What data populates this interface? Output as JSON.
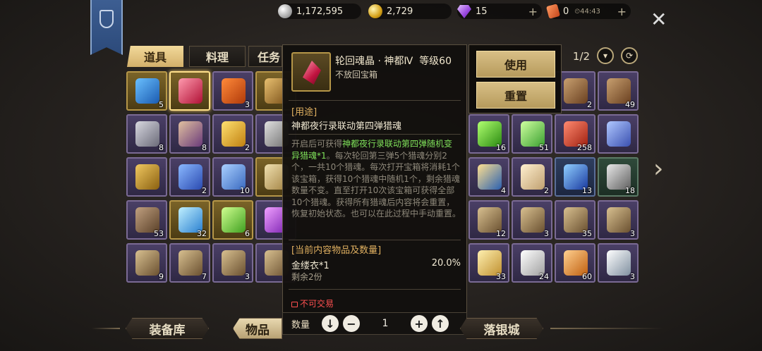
{
  "currency": {
    "silver": "1,172,595",
    "gold": "2,729",
    "gems": "15",
    "tickets": "0",
    "timer": "44:43"
  },
  "tabs": [
    "道具",
    "料理",
    "任务"
  ],
  "pager": "1/2",
  "tooltip": {
    "title": "轮回魂晶 · 神都Ⅳ",
    "level": "等级60",
    "subtitle": "不放回宝箱",
    "usage_header": "[用途]",
    "usage_text": "神都夜行录联动第四弹猎魂",
    "desc_pre": "开启后可获得",
    "desc_highlight": "神都夜行录联动第四弹随机变异猎魂*1",
    "desc_post": "。每次轮回第三弹5个猎魂分别2个，一共10个猎魂。每次打开宝箱将消耗1个该宝箱，获得10个猎魂中随机1个，剩余猎魂数量不变。直至打开10次该宝箱可获得全部10个猎魂。获得所有猎魂后内容将会重置，恢复初始状态。也可以在此过程中手动重置。",
    "contents_header": "[当前内容物品及数量]",
    "item_name": "金缕衣*1",
    "item_chance": "20.0%",
    "item_remaining": "剩余2份",
    "no_trade": "不可交易"
  },
  "actions": {
    "use": "使用",
    "reset": "重置"
  },
  "quantity": {
    "label": "数量",
    "value": "1"
  },
  "bottom_nav": [
    "装备库",
    "物品",
    "落银城"
  ],
  "grid_left": [
    [
      {
        "c": "5",
        "icon": "book-icon",
        "bg": "gold"
      },
      {
        "c": "",
        "icon": "crystal-icon",
        "bg": "gold",
        "sel": true
      },
      {
        "c": "3",
        "icon": "gift-box-icon",
        "bg": "purple"
      },
      {
        "c": "",
        "icon": "chest-icon",
        "bg": "gold"
      }
    ],
    [
      {
        "c": "8",
        "icon": "bottle-icon",
        "bg": "purple"
      },
      {
        "c": "8",
        "icon": "potion-icon",
        "bg": "purple"
      },
      {
        "c": "2",
        "icon": "gold-hat-icon",
        "bg": "purple"
      },
      {
        "c": "",
        "icon": "helmet-icon",
        "bg": "purple"
      }
    ],
    [
      {
        "c": "",
        "icon": "hook-icon",
        "bg": "purple"
      },
      {
        "c": "2",
        "icon": "blue-flag-icon",
        "bg": "purple"
      },
      {
        "c": "10",
        "icon": "banner-icon",
        "bg": "purple"
      },
      {
        "c": "",
        "icon": "scroll-icon",
        "bg": "gold"
      }
    ],
    [
      {
        "c": "53",
        "icon": "backpack-icon",
        "bg": "purple"
      },
      {
        "c": "32",
        "icon": "blue-crystal-icon",
        "bg": "gold"
      },
      {
        "c": "6",
        "icon": "green-gem-icon",
        "bg": "gold"
      },
      {
        "c": "",
        "icon": "purple-gem-icon",
        "bg": "purple"
      }
    ],
    [
      {
        "c": "9",
        "icon": "map-scroll-icon",
        "bg": "purple"
      },
      {
        "c": "7",
        "icon": "map-scroll-icon",
        "bg": "purple"
      },
      {
        "c": "3",
        "icon": "map-scroll-icon",
        "bg": "purple"
      },
      {
        "c": "",
        "icon": "map-scroll-icon",
        "bg": "purple"
      }
    ]
  ],
  "grid_right": [
    [
      {
        "c": "",
        "icon": "empty",
        "bg": "none"
      },
      {
        "c": "",
        "icon": "empty",
        "bg": "none"
      },
      {
        "c": "2",
        "icon": "money-bag-icon",
        "bg": "purple"
      },
      {
        "c": "49",
        "icon": "money-bag-icon",
        "bg": "purple"
      }
    ],
    [
      {
        "c": "16",
        "icon": "green-pepper-icon",
        "bg": "purple"
      },
      {
        "c": "51",
        "icon": "green-potion-icon",
        "bg": "purple"
      },
      {
        "c": "258",
        "icon": "red-ticket-icon",
        "bg": "purple"
      },
      {
        "c": "",
        "icon": "blue-ticket-icon",
        "bg": "purple"
      }
    ],
    [
      {
        "c": "4",
        "icon": "compass-medal-icon",
        "bg": "purple"
      },
      {
        "c": "2",
        "icon": "letter-icon",
        "bg": "purple"
      },
      {
        "c": "13",
        "icon": "butterfly-icon",
        "bg": "blue"
      },
      {
        "c": "18",
        "icon": "frame-icon",
        "bg": "green"
      }
    ],
    [
      {
        "c": "12",
        "icon": "map-scroll-icon",
        "bg": "purple"
      },
      {
        "c": "3",
        "icon": "map-scroll-icon",
        "bg": "purple"
      },
      {
        "c": "35",
        "icon": "map-scroll-icon",
        "bg": "purple"
      },
      {
        "c": "3",
        "icon": "map-scroll-icon",
        "bg": "purple"
      }
    ],
    [
      {
        "c": "33",
        "icon": "gold-candle-icon",
        "bg": "purple"
      },
      {
        "c": "24",
        "icon": "white-candle-icon",
        "bg": "purple"
      },
      {
        "c": "60",
        "icon": "orange-candle-icon",
        "bg": "purple"
      },
      {
        "c": "3",
        "icon": "silver-candle-icon",
        "bg": "purple"
      }
    ]
  ],
  "colors": {
    "accent": "#e0b060",
    "highlight": "#7fe05a",
    "warning": "#ff5050"
  }
}
